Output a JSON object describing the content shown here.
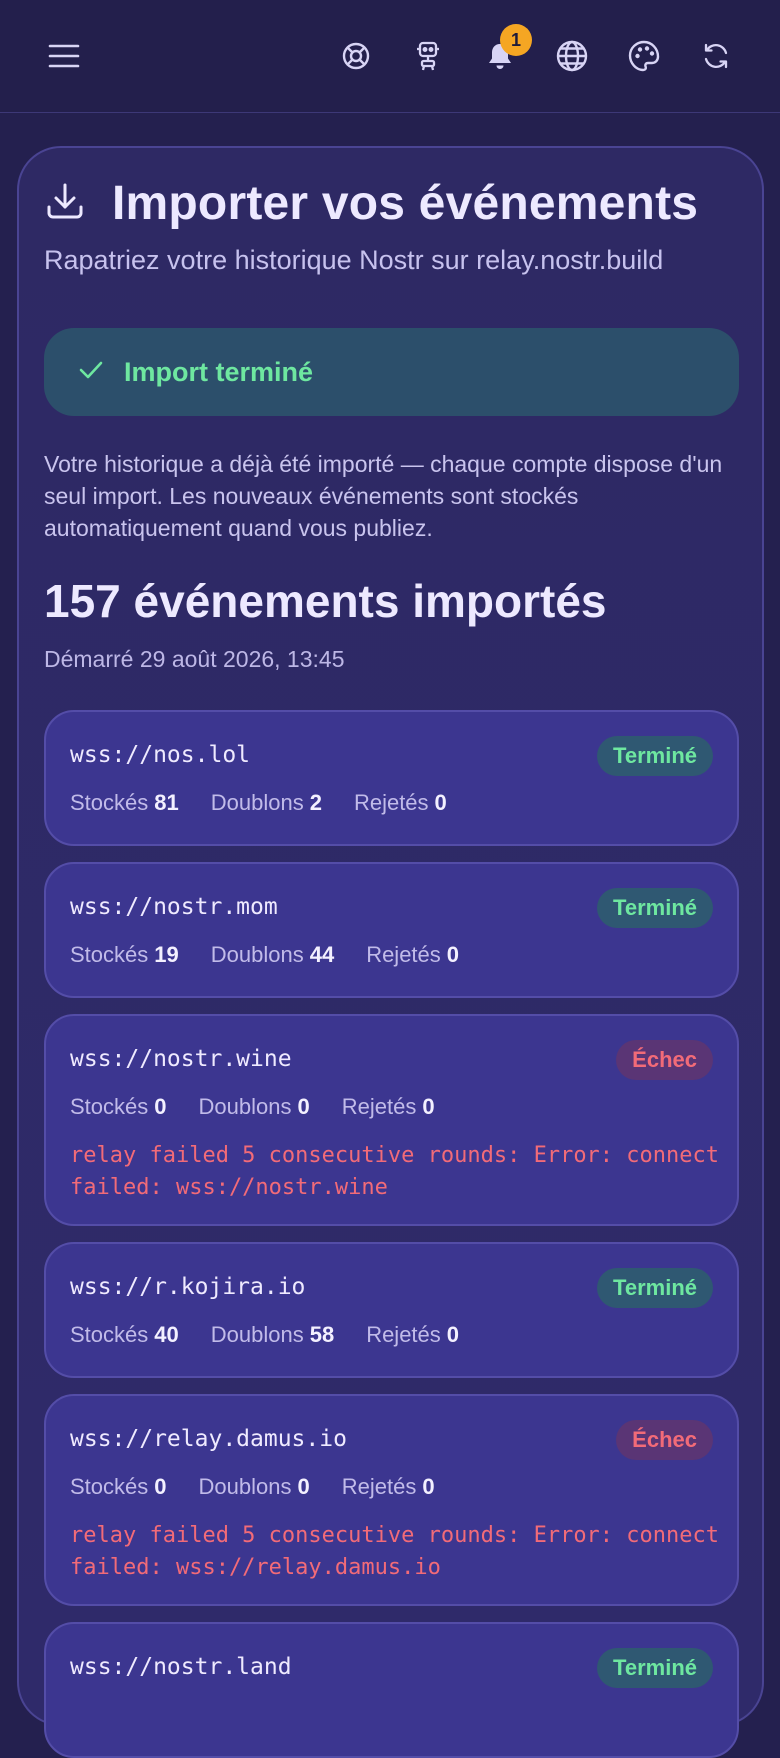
{
  "header": {
    "menu_icon": "hamburger-menu-icon",
    "notifications_count": "1",
    "icons": [
      "lifebuoy-icon",
      "robot-icon",
      "bell-icon",
      "globe-icon",
      "palette-icon",
      "refresh-icon"
    ]
  },
  "page": {
    "title": "Importer vos événements",
    "title_icon": "download-icon",
    "subtitle": "Rapatriez votre historique Nostr sur relay.nostr.build",
    "status_banner": "Import terminé",
    "description": "Votre historique a déjà été importé — chaque compte dispose d'un seul import. Les nouveaux événements sont stockés automatiquement quand vous publiez.",
    "imported_count": "157 événements importés",
    "started": "Démarré 29 août 2026, 13:45"
  },
  "labels": {
    "stored": "Stockés",
    "duplicates": "Doublons",
    "rejected": "Rejetés"
  },
  "relays": [
    {
      "url": "wss://nos.lol",
      "status": "Terminé",
      "stored": "81",
      "duplicates": "2",
      "rejected": "0",
      "error": ""
    },
    {
      "url": "wss://nostr.mom",
      "status": "Terminé",
      "stored": "19",
      "duplicates": "44",
      "rejected": "0",
      "error": ""
    },
    {
      "url": "wss://nostr.wine",
      "status": "Échec",
      "stored": "0",
      "duplicates": "0",
      "rejected": "0",
      "error": "relay failed 5 consecutive rounds: Error: connect failed: wss://nostr.wine"
    },
    {
      "url": "wss://r.kojira.io",
      "status": "Terminé",
      "stored": "40",
      "duplicates": "58",
      "rejected": "0",
      "error": ""
    },
    {
      "url": "wss://relay.damus.io",
      "status": "Échec",
      "stored": "0",
      "duplicates": "0",
      "rejected": "0",
      "error": "relay failed 5 consecutive rounds: Error: connect failed: wss://relay.damus.io"
    },
    {
      "url": "wss://nostr.land",
      "status": "Terminé",
      "stored": "",
      "duplicates": "",
      "rejected": "",
      "error": ""
    }
  ],
  "colors": {
    "background": "#24204f",
    "success": "#6ee7a0",
    "error": "#f26b78",
    "badge": "#f5a623"
  }
}
